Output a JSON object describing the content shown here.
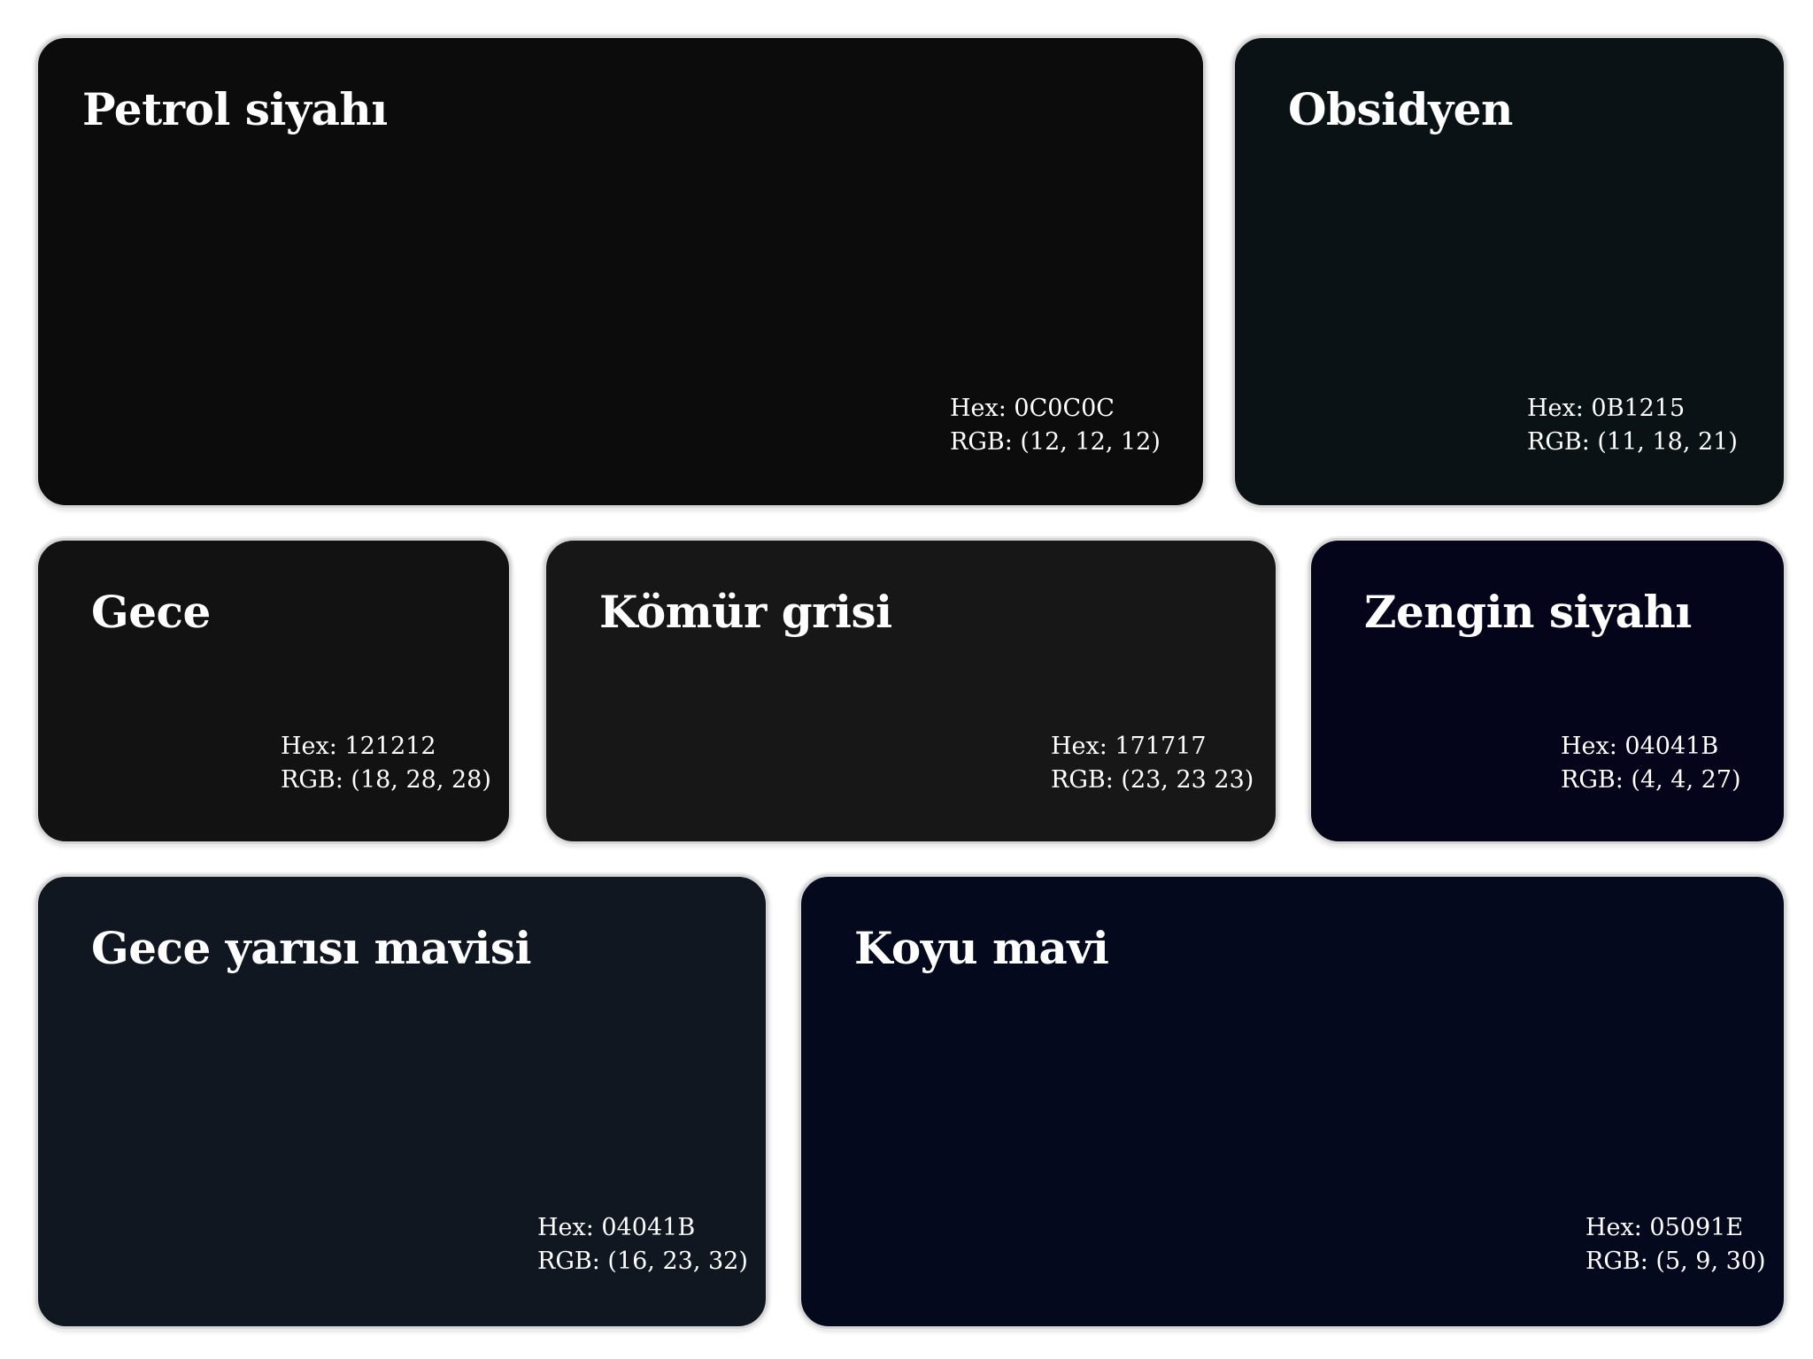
{
  "swatches": [
    {
      "name": "Petrol siyahı",
      "hex": "Hex: 0C0C0C",
      "rgb": "RGB: (12, 12, 12)",
      "color": "#0c0c0c"
    },
    {
      "name": "Obsidyen",
      "hex": "Hex: 0B1215",
      "rgb": "RGB: (11, 18, 21)",
      "color": "#0b1215"
    },
    {
      "name": "Gece",
      "hex": "Hex: 121212",
      "rgb": "RGB: (18, 28, 28)",
      "color": "#121212"
    },
    {
      "name": "Kömür grisi",
      "hex": "Hex: 171717",
      "rgb": "RGB: (23, 23 23)",
      "color": "#171717"
    },
    {
      "name": "Zengin siyahı",
      "hex": "Hex: 04041B",
      "rgb": "RGB: (4, 4, 27)",
      "color": "#04041b"
    },
    {
      "name": "Gece yarısı mavisi",
      "hex": "Hex: 04041B",
      "rgb": "RGB: (16, 23, 32)",
      "color": "#101720"
    },
    {
      "name": "Koyu mavi",
      "hex": "Hex: 05091E",
      "rgb": "RGB: (5, 9, 30)",
      "color": "#05091e"
    }
  ]
}
